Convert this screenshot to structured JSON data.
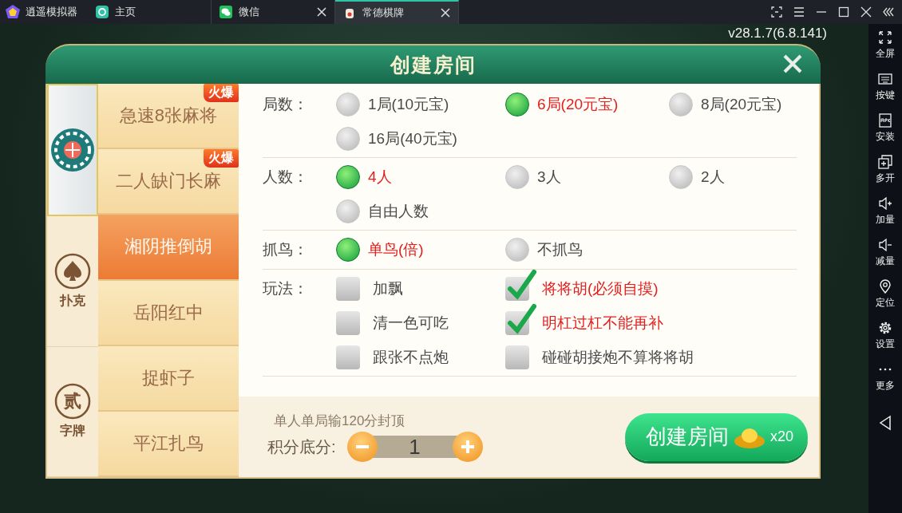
{
  "emulator": {
    "app_name": "逍遥模拟器",
    "tabs": [
      {
        "label": "主页",
        "selected": false,
        "closable": false
      },
      {
        "label": "微信",
        "selected": false,
        "closable": true
      },
      {
        "label": "常德棋牌",
        "selected": true,
        "closable": true
      }
    ]
  },
  "sidebar": {
    "items": [
      {
        "label": "全屏",
        "kind": "fullscreen"
      },
      {
        "label": "按键",
        "kind": "keyboard"
      },
      {
        "label": "安装",
        "kind": "apk"
      },
      {
        "label": "多开",
        "kind": "multi"
      },
      {
        "label": "加量",
        "kind": "volup"
      },
      {
        "label": "减量",
        "kind": "voldown"
      },
      {
        "label": "定位",
        "kind": "location"
      },
      {
        "label": "设置",
        "kind": "settings"
      },
      {
        "label": "更多",
        "kind": "more"
      }
    ]
  },
  "game": {
    "version": "v28.1.7(6.8.141)",
    "dialog": {
      "title": "创建房间",
      "categories": [
        {
          "kind": "mahjong",
          "selected": true
        },
        {
          "kind": "poker",
          "label": "扑克",
          "selected": false
        },
        {
          "kind": "zipai",
          "glyph": "贰",
          "label": "字牌",
          "selected": false
        }
      ],
      "games": [
        {
          "name": "急速8张麻将",
          "badge": "火爆",
          "selected": false
        },
        {
          "name": "二人缺门长麻",
          "badge": "火爆",
          "selected": false
        },
        {
          "name": "湘阴推倒胡",
          "selected": true
        },
        {
          "name": "岳阳红中",
          "selected": false
        },
        {
          "name": "捉虾子",
          "selected": false
        },
        {
          "name": "平江扎鸟",
          "selected": false
        }
      ],
      "rules": [
        {
          "label": "局数：",
          "options": [
            {
              "kind": "radio",
              "text": "1局(10元宝)",
              "selected": false
            },
            {
              "kind": "radio",
              "text": "6局(20元宝)",
              "selected": true
            },
            {
              "kind": "radio",
              "text": "8局(20元宝)",
              "selected": false
            },
            {
              "kind": "radio",
              "text": "16局(40元宝)",
              "selected": false
            }
          ]
        },
        {
          "label": "人数：",
          "options": [
            {
              "kind": "radio",
              "text": "4人",
              "selected": true
            },
            {
              "kind": "radio",
              "text": "3人",
              "selected": false
            },
            {
              "kind": "radio",
              "text": "2人",
              "selected": false
            },
            {
              "kind": "radio",
              "text": "自由人数",
              "selected": false
            }
          ]
        },
        {
          "label": "抓鸟：",
          "options": [
            {
              "kind": "radio",
              "text": "单鸟(倍)",
              "selected": true
            },
            {
              "kind": "radio",
              "text": "不抓鸟",
              "selected": false
            }
          ]
        },
        {
          "label": "玩法：",
          "options": [
            {
              "kind": "checkbox",
              "text": "加飘",
              "checked": false
            },
            {
              "kind": "checkbox",
              "text": "将将胡(必须自摸)",
              "checked": true
            },
            {
              "kind": "checkbox",
              "text": "清一色可吃",
              "checked": false
            },
            {
              "kind": "checkbox",
              "text": "明杠过杠不能再补",
              "checked": true
            },
            {
              "kind": "checkbox",
              "text": "跟张不点炮",
              "checked": false
            },
            {
              "kind": "checkbox",
              "text": "碰碰胡接炮不算将将胡",
              "checked": false
            }
          ]
        }
      ],
      "cap_note": "单人单局输120分封顶",
      "base_score": {
        "label": "积分底分:",
        "value": "1"
      },
      "create_button": {
        "label": "创建房间",
        "cost": "x20"
      }
    }
  }
}
